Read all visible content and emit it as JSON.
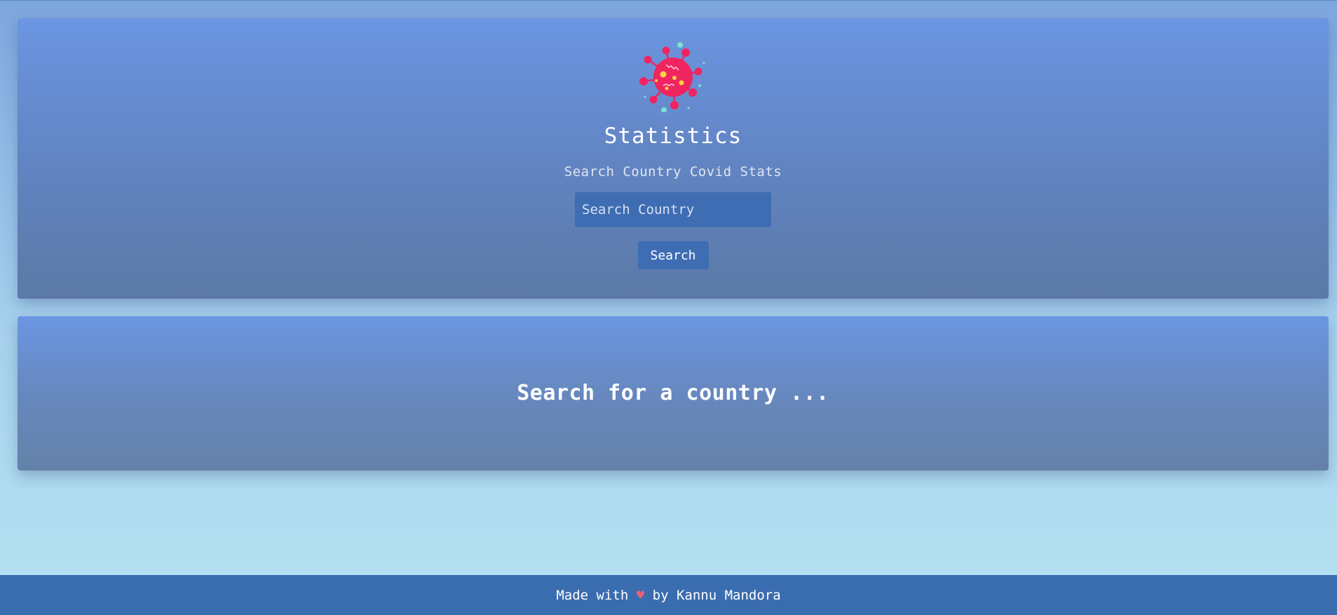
{
  "header": {
    "title": "Statistics",
    "subtitle": "Search Country Covid Stats",
    "logo_icon": "virus-icon",
    "search": {
      "placeholder": "Search Country",
      "value": "",
      "button_label": "Search"
    }
  },
  "result": {
    "message": "Search for a country ..."
  },
  "footer": {
    "prefix": "Made with ",
    "heart": "♥",
    "suffix": " by Kannu Mandora"
  },
  "colors": {
    "accent": "#3f6db3",
    "footer_bg": "#3a6cb0",
    "virus_body": "#f0245f",
    "virus_dots": "#ffd23f",
    "spores": "#7fe0d0",
    "heart": "#e8607a"
  }
}
